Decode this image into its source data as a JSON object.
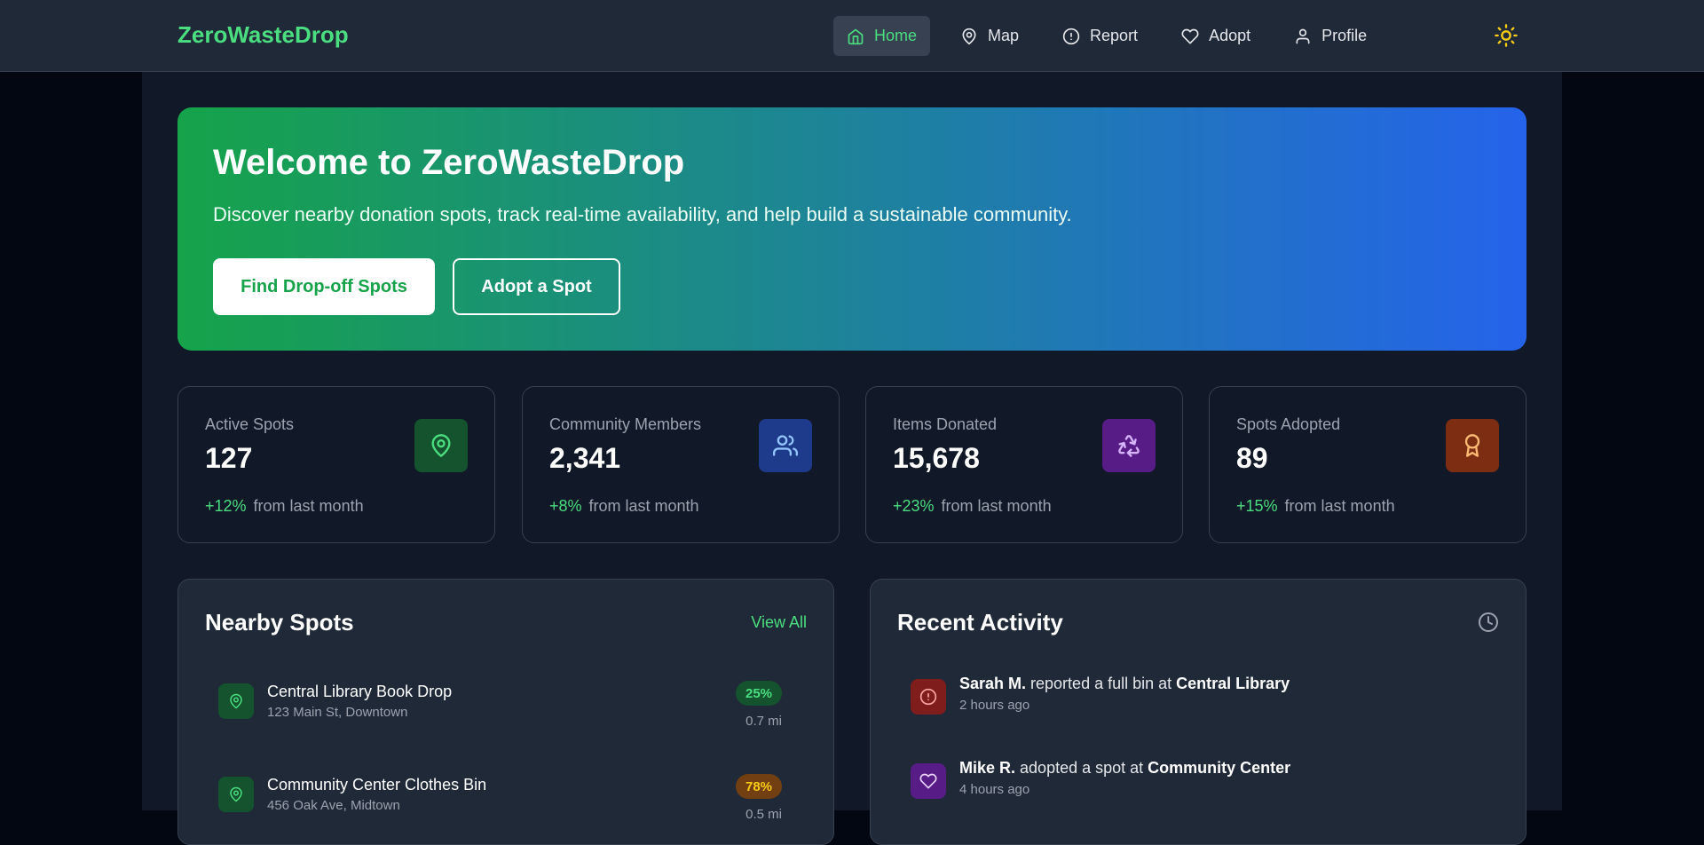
{
  "nav": {
    "brand": "ZeroWasteDrop",
    "items": [
      {
        "label": "Home",
        "icon": "home-icon",
        "active": true
      },
      {
        "label": "Map",
        "icon": "map-pin-icon"
      },
      {
        "label": "Report",
        "icon": "alert-circle-icon"
      },
      {
        "label": "Adopt",
        "icon": "heart-icon"
      },
      {
        "label": "Profile",
        "icon": "user-icon"
      }
    ],
    "theme_icon": "sun-icon"
  },
  "hero": {
    "title": "Welcome to ZeroWasteDrop",
    "subtitle": "Discover nearby donation spots, track real-time availability, and help build a sustainable community.",
    "primary_button": "Find Drop-off Spots",
    "secondary_button": "Adopt a Spot",
    "gradient_start": "#16a34a",
    "gradient_end": "#2563eb"
  },
  "stats": [
    {
      "label": "Active Spots",
      "value": "127",
      "change": "+12%",
      "suffix": "from last month",
      "icon": "map-pin-icon",
      "color": "#14532d",
      "icon_color": "#4ade80"
    },
    {
      "label": "Community Members",
      "value": "2,341",
      "change": "+8%",
      "suffix": "from last month",
      "icon": "users-icon",
      "color": "#1e3a8a",
      "icon_color": "#93c5fd"
    },
    {
      "label": "Items Donated",
      "value": "15,678",
      "change": "+23%",
      "suffix": "from last month",
      "icon": "recycle-icon",
      "color": "#581c87",
      "icon_color": "#d8b4fe"
    },
    {
      "label": "Spots Adopted",
      "value": "89",
      "change": "+15%",
      "suffix": "from last month",
      "icon": "award-icon",
      "color": "#7c2d12",
      "icon_color": "#fdba74"
    }
  ],
  "nearby": {
    "title": "Nearby Spots",
    "view_all": "View All",
    "spots": [
      {
        "name": "Central Library Book Drop",
        "address": "123 Main St, Downtown",
        "fill": "25%",
        "distance": "0.7 mi",
        "badge_bg": "#14532d",
        "badge_fg": "#4ade80"
      },
      {
        "name": "Community Center Clothes Bin",
        "address": "456 Oak Ave, Midtown",
        "fill": "78%",
        "distance": "0.5 mi",
        "badge_bg": "#713f12",
        "badge_fg": "#facc15"
      }
    ]
  },
  "activity": {
    "title": "Recent Activity",
    "icon": "clock-icon",
    "items": [
      {
        "user": "Sarah M.",
        "action": " reported a full bin at ",
        "place": "Central Library",
        "time": "2 hours ago",
        "icon": "alert-circle-icon",
        "bg": "#7f1d1d",
        "fg": "#fca5a5"
      },
      {
        "user": "Mike R.",
        "action": " adopted a spot at ",
        "place": "Community Center",
        "time": "4 hours ago",
        "icon": "heart-icon",
        "bg": "#581c87",
        "fg": "#e9d5ff"
      }
    ]
  }
}
